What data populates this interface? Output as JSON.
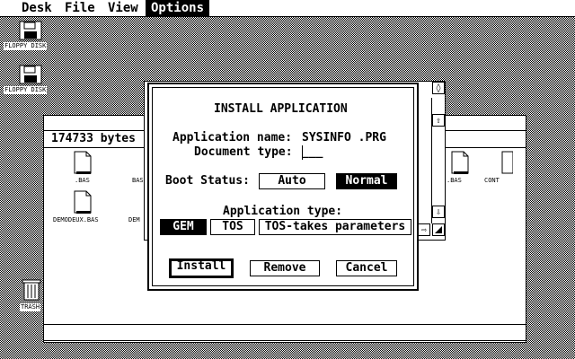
{
  "menubar": {
    "items": [
      {
        "label": "Desk",
        "active": false
      },
      {
        "label": "File",
        "active": false
      },
      {
        "label": "View",
        "active": false
      },
      {
        "label": "Options",
        "active": true
      }
    ]
  },
  "desktop": {
    "floppy_a_label": "FLOPPY DISK",
    "floppy_b_label": "FLOPPY DISK",
    "trash_label": "TRASH"
  },
  "file_window": {
    "free_space": "174733 bytes",
    "files": [
      {
        "name": ".BAS"
      },
      {
        "name": "BAS"
      },
      {
        "name": "DEMODEUX.BAS"
      },
      {
        "name": "DEM"
      },
      {
        "name": ".BAS"
      },
      {
        "name": "CONT"
      }
    ],
    "scroll_up": "⇧",
    "scroll_down": "⇩",
    "scroll_right": "⇨",
    "close_glyph": "◊"
  },
  "dialog": {
    "title": "INSTALL APPLICATION",
    "app_name_label": "Application name:",
    "app_name_value": "SYSINFO .PRG",
    "doc_type_label": "Document type:",
    "doc_type_value": "___",
    "boot_status_label": "Boot Status:",
    "boot_options": [
      {
        "label": "Auto",
        "selected": false
      },
      {
        "label": "Normal",
        "selected": true
      }
    ],
    "app_type_label": "Application type:",
    "app_types": [
      {
        "label": "GEM",
        "selected": true
      },
      {
        "label": "TOS",
        "selected": false
      },
      {
        "label": "TOS-takes parameters",
        "selected": false
      }
    ],
    "install_label": "Install",
    "remove_label": "Remove",
    "cancel_label": "Cancel"
  }
}
